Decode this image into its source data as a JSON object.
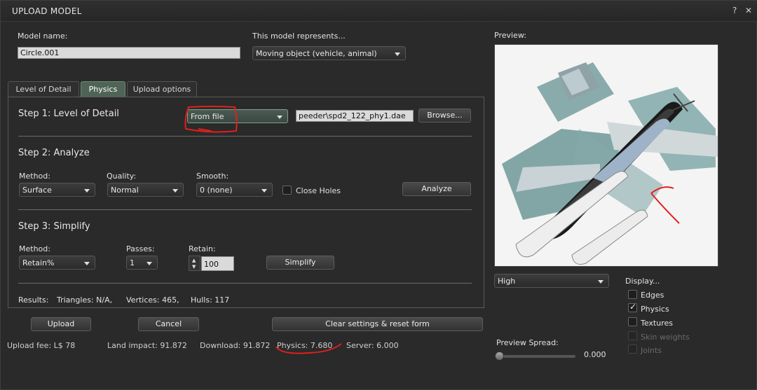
{
  "window": {
    "title": "UPLOAD MODEL",
    "help": "?",
    "close": "✕"
  },
  "model_name": {
    "label": "Model name:",
    "value": "Circle.001"
  },
  "represents": {
    "label": "This model represents...",
    "value": "Moving object (vehicle, animal)"
  },
  "tabs": [
    {
      "label": "Level of Detail"
    },
    {
      "label": "Physics"
    },
    {
      "label": "Upload options"
    }
  ],
  "step1": {
    "title": "Step 1: Level of Detail",
    "source": "From file",
    "file": "peeder\\spd2_122_phy1.dae",
    "browse": "Browse..."
  },
  "step2": {
    "title": "Step 2: Analyze",
    "method_label": "Method:",
    "method_value": "Surface",
    "quality_label": "Quality:",
    "quality_value": "Normal",
    "smooth_label": "Smooth:",
    "smooth_value": "0 (none)",
    "close_holes": "Close Holes",
    "analyze": "Analyze"
  },
  "step3": {
    "title": "Step 3: Simplify",
    "method_label": "Method:",
    "method_value": "Retain%",
    "passes_label": "Passes:",
    "passes_value": "1",
    "retain_label": "Retain:",
    "retain_value": "100",
    "simplify": "Simplify"
  },
  "results": {
    "label": "Results:",
    "triangles": "Triangles: N/A,",
    "vertices": "Vertices: 465,",
    "hulls": "Hulls: 117"
  },
  "buttons": {
    "upload": "Upload",
    "cancel": "Cancel",
    "clear": "Clear settings & reset form"
  },
  "footer": {
    "fee": "Upload fee: L$ 78",
    "land": "Land impact: 91.872",
    "download": "Download: 91.872",
    "physics": "Physics: 7.680",
    "server": "Server: 6.000"
  },
  "preview": {
    "label": "Preview:",
    "lod": "High",
    "spread_label": "Preview Spread:",
    "spread_value": "0.000",
    "display_label": "Display...",
    "options": [
      {
        "label": "Edges",
        "checked": false,
        "enabled": true
      },
      {
        "label": "Physics",
        "checked": true,
        "enabled": true
      },
      {
        "label": "Textures",
        "checked": false,
        "enabled": true
      },
      {
        "label": "Skin weights",
        "checked": false,
        "enabled": false
      },
      {
        "label": "Joints",
        "checked": false,
        "enabled": false
      }
    ]
  },
  "colors": {
    "active_tab": "#4f6457",
    "annotation": "#e0201e",
    "background": "#2a2a2a"
  }
}
